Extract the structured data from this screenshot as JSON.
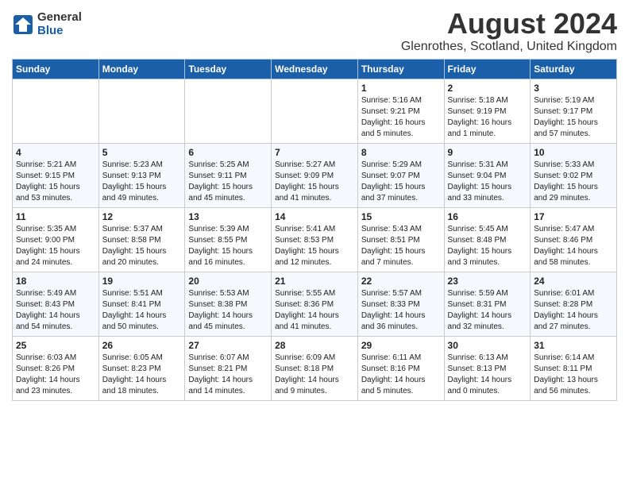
{
  "header": {
    "logo_general": "General",
    "logo_blue": "Blue",
    "main_title": "August 2024",
    "subtitle": "Glenrothes, Scotland, United Kingdom"
  },
  "days_of_week": [
    "Sunday",
    "Monday",
    "Tuesday",
    "Wednesday",
    "Thursday",
    "Friday",
    "Saturday"
  ],
  "weeks": [
    [
      {
        "day": "",
        "text": ""
      },
      {
        "day": "",
        "text": ""
      },
      {
        "day": "",
        "text": ""
      },
      {
        "day": "",
        "text": ""
      },
      {
        "day": "1",
        "text": "Sunrise: 5:16 AM\nSunset: 9:21 PM\nDaylight: 16 hours\nand 5 minutes."
      },
      {
        "day": "2",
        "text": "Sunrise: 5:18 AM\nSunset: 9:19 PM\nDaylight: 16 hours\nand 1 minute."
      },
      {
        "day": "3",
        "text": "Sunrise: 5:19 AM\nSunset: 9:17 PM\nDaylight: 15 hours\nand 57 minutes."
      }
    ],
    [
      {
        "day": "4",
        "text": "Sunrise: 5:21 AM\nSunset: 9:15 PM\nDaylight: 15 hours\nand 53 minutes."
      },
      {
        "day": "5",
        "text": "Sunrise: 5:23 AM\nSunset: 9:13 PM\nDaylight: 15 hours\nand 49 minutes."
      },
      {
        "day": "6",
        "text": "Sunrise: 5:25 AM\nSunset: 9:11 PM\nDaylight: 15 hours\nand 45 minutes."
      },
      {
        "day": "7",
        "text": "Sunrise: 5:27 AM\nSunset: 9:09 PM\nDaylight: 15 hours\nand 41 minutes."
      },
      {
        "day": "8",
        "text": "Sunrise: 5:29 AM\nSunset: 9:07 PM\nDaylight: 15 hours\nand 37 minutes."
      },
      {
        "day": "9",
        "text": "Sunrise: 5:31 AM\nSunset: 9:04 PM\nDaylight: 15 hours\nand 33 minutes."
      },
      {
        "day": "10",
        "text": "Sunrise: 5:33 AM\nSunset: 9:02 PM\nDaylight: 15 hours\nand 29 minutes."
      }
    ],
    [
      {
        "day": "11",
        "text": "Sunrise: 5:35 AM\nSunset: 9:00 PM\nDaylight: 15 hours\nand 24 minutes."
      },
      {
        "day": "12",
        "text": "Sunrise: 5:37 AM\nSunset: 8:58 PM\nDaylight: 15 hours\nand 20 minutes."
      },
      {
        "day": "13",
        "text": "Sunrise: 5:39 AM\nSunset: 8:55 PM\nDaylight: 15 hours\nand 16 minutes."
      },
      {
        "day": "14",
        "text": "Sunrise: 5:41 AM\nSunset: 8:53 PM\nDaylight: 15 hours\nand 12 minutes."
      },
      {
        "day": "15",
        "text": "Sunrise: 5:43 AM\nSunset: 8:51 PM\nDaylight: 15 hours\nand 7 minutes."
      },
      {
        "day": "16",
        "text": "Sunrise: 5:45 AM\nSunset: 8:48 PM\nDaylight: 15 hours\nand 3 minutes."
      },
      {
        "day": "17",
        "text": "Sunrise: 5:47 AM\nSunset: 8:46 PM\nDaylight: 14 hours\nand 58 minutes."
      }
    ],
    [
      {
        "day": "18",
        "text": "Sunrise: 5:49 AM\nSunset: 8:43 PM\nDaylight: 14 hours\nand 54 minutes."
      },
      {
        "day": "19",
        "text": "Sunrise: 5:51 AM\nSunset: 8:41 PM\nDaylight: 14 hours\nand 50 minutes."
      },
      {
        "day": "20",
        "text": "Sunrise: 5:53 AM\nSunset: 8:38 PM\nDaylight: 14 hours\nand 45 minutes."
      },
      {
        "day": "21",
        "text": "Sunrise: 5:55 AM\nSunset: 8:36 PM\nDaylight: 14 hours\nand 41 minutes."
      },
      {
        "day": "22",
        "text": "Sunrise: 5:57 AM\nSunset: 8:33 PM\nDaylight: 14 hours\nand 36 minutes."
      },
      {
        "day": "23",
        "text": "Sunrise: 5:59 AM\nSunset: 8:31 PM\nDaylight: 14 hours\nand 32 minutes."
      },
      {
        "day": "24",
        "text": "Sunrise: 6:01 AM\nSunset: 8:28 PM\nDaylight: 14 hours\nand 27 minutes."
      }
    ],
    [
      {
        "day": "25",
        "text": "Sunrise: 6:03 AM\nSunset: 8:26 PM\nDaylight: 14 hours\nand 23 minutes."
      },
      {
        "day": "26",
        "text": "Sunrise: 6:05 AM\nSunset: 8:23 PM\nDaylight: 14 hours\nand 18 minutes."
      },
      {
        "day": "27",
        "text": "Sunrise: 6:07 AM\nSunset: 8:21 PM\nDaylight: 14 hours\nand 14 minutes."
      },
      {
        "day": "28",
        "text": "Sunrise: 6:09 AM\nSunset: 8:18 PM\nDaylight: 14 hours\nand 9 minutes."
      },
      {
        "day": "29",
        "text": "Sunrise: 6:11 AM\nSunset: 8:16 PM\nDaylight: 14 hours\nand 5 minutes."
      },
      {
        "day": "30",
        "text": "Sunrise: 6:13 AM\nSunset: 8:13 PM\nDaylight: 14 hours\nand 0 minutes."
      },
      {
        "day": "31",
        "text": "Sunrise: 6:14 AM\nSunset: 8:11 PM\nDaylight: 13 hours\nand 56 minutes."
      }
    ]
  ]
}
